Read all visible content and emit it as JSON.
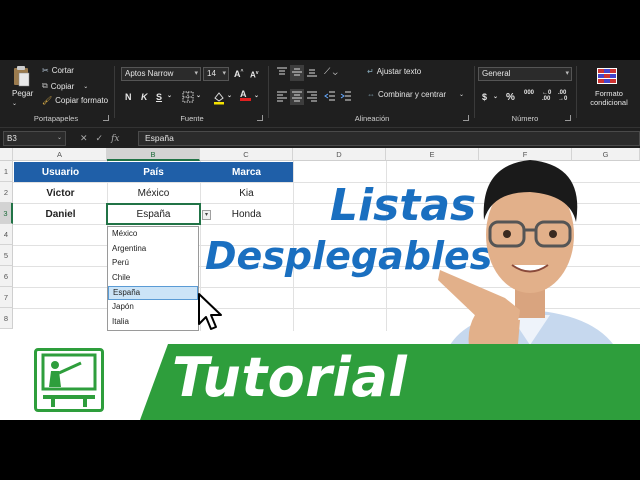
{
  "ribbon": {
    "clipboard": {
      "paste": "Pegar",
      "cut": "Cortar",
      "copy": "Copiar",
      "format_painter": "Copiar formato",
      "label": "Portapapeles"
    },
    "font": {
      "family": "Aptos Narrow",
      "size": "14",
      "label": "Fuente",
      "bold": "N",
      "italic": "K",
      "underline": "S"
    },
    "alignment": {
      "wrap": "Ajustar texto",
      "merge": "Combinar y centrar",
      "label": "Alineación"
    },
    "number": {
      "format": "General",
      "label": "Número",
      "currency": "$",
      "percent": "%"
    },
    "styles": {
      "conditional": "Formato condicional"
    }
  },
  "formula_bar": {
    "name_box": "B3",
    "fx": "fx",
    "content": "España"
  },
  "columns": [
    "A",
    "B",
    "C",
    "D",
    "E",
    "F",
    "G"
  ],
  "rows": [
    "1",
    "2",
    "3",
    "4",
    "5",
    "6",
    "7",
    "8"
  ],
  "table": {
    "headers": [
      "Usuario",
      "País",
      "Marca"
    ],
    "rows": [
      [
        "Victor",
        "México",
        "Kia"
      ],
      [
        "Daniel",
        "España",
        "Honda"
      ]
    ]
  },
  "dropdown": {
    "items": [
      "México",
      "Argentina",
      "Perú",
      "Chile",
      "España",
      "Japón",
      "Italia"
    ],
    "selected_index": 4
  },
  "overlay": {
    "line1": "Listas",
    "line2": "Desplegables",
    "banner": "Tutorial"
  },
  "colors": {
    "header_blue": "#1f5fa8",
    "title_blue": "#1a6fc0",
    "banner_green": "#2e9e3c",
    "excel_green": "#217346"
  }
}
